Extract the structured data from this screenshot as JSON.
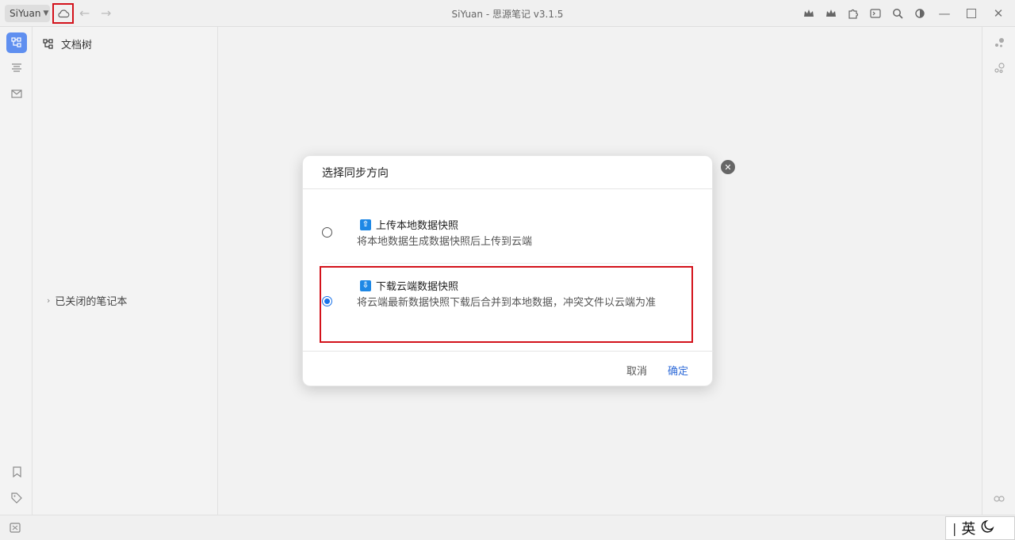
{
  "titlebar": {
    "workspace": "SiYuan",
    "title": "SiYuan - 思源笔记 v3.1.5",
    "icons": [
      "crown-icon",
      "crown-icon",
      "puzzle-icon",
      "terminal-icon",
      "search-icon",
      "contrast-icon"
    ],
    "window_controls": [
      "minimize-icon",
      "maximize-icon",
      "close-icon"
    ]
  },
  "left_dock": {
    "items": [
      "file-tree-icon",
      "outline-icon",
      "inbox-icon",
      "bookmark-icon",
      "tag-icon"
    ]
  },
  "tree": {
    "header": "文档树",
    "closed_notebooks": "已关闭的笔记本"
  },
  "dialog": {
    "title": "选择同步方向",
    "options": [
      {
        "label": "上传本地数据快照",
        "desc": "将本地数据生成数据快照后上传到云端",
        "badge": "⇧",
        "selected": false
      },
      {
        "label": "下载云端数据快照",
        "desc": "将云端最新数据快照下载后合并到本地数据，冲突文件以云端为准",
        "badge": "⇩",
        "selected": true
      }
    ],
    "cancel": "取消",
    "ok": "确定"
  },
  "statusbar": {
    "ime": "英"
  }
}
